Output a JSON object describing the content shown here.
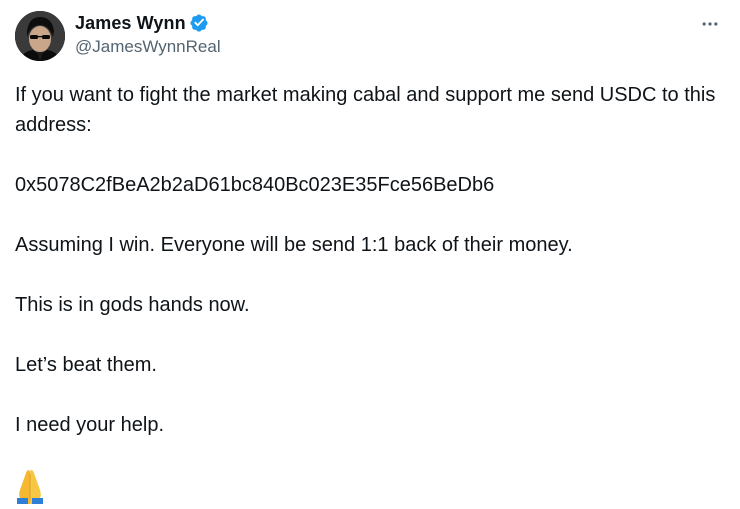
{
  "tweet": {
    "author": {
      "display_name": "James Wynn",
      "handle": "@JamesWynnReal",
      "verified": true
    },
    "more_icon": "more-horizontal-icon",
    "paragraphs": [
      "If you want to fight the market making cabal and support me send USDC to this address:",
      "0x5078C2fBeA2b2aD61bc840Bc023E35Fce56BeDb6",
      "Assuming I win. Everyone will be send 1:1 back of their money.",
      "This is in gods hands now.",
      "Let’s beat them.",
      "I need your help."
    ],
    "emoji": "folded-hands-emoji",
    "colors": {
      "text": "#0f1419",
      "secondary": "#536471",
      "verified_badge": "#1d9bf0"
    }
  }
}
